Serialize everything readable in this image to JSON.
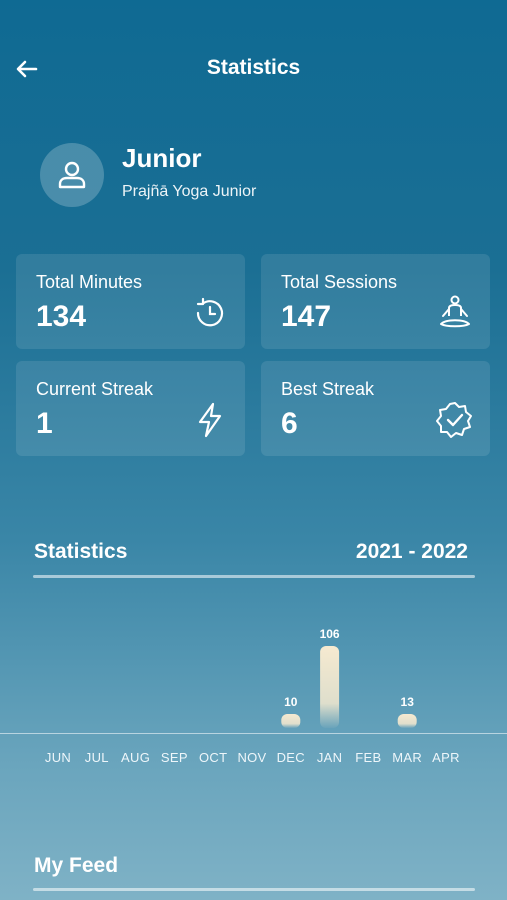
{
  "header": {
    "title": "Statistics",
    "back_icon": "arrow-left-icon"
  },
  "profile": {
    "name": "Junior",
    "subtitle": "Prajñā Yoga Junior",
    "avatar_icon": "user-icon"
  },
  "stats": [
    {
      "label": "Total Minutes",
      "value": "134",
      "icon": "timer-icon"
    },
    {
      "label": "Total Sessions",
      "value": "147",
      "icon": "meditation-icon"
    },
    {
      "label": "Current Streak",
      "value": "1",
      "icon": "lightning-icon"
    },
    {
      "label": "Best Streak",
      "value": "6",
      "icon": "badge-check-icon"
    }
  ],
  "statistics": {
    "title": "Statistics",
    "range": "2021 - 2022"
  },
  "chart_data": {
    "type": "bar",
    "categories": [
      "JUN",
      "JUL",
      "AUG",
      "SEP",
      "OCT",
      "NOV",
      "DEC",
      "JAN",
      "FEB",
      "MAR",
      "APR"
    ],
    "values": [
      0,
      0,
      0,
      0,
      0,
      0,
      10,
      106,
      0,
      13,
      0
    ],
    "title": "",
    "xlabel": "",
    "ylabel": ""
  },
  "feed": {
    "title": "My Feed"
  },
  "colors": {
    "bar": "#f6ead0",
    "background_top": "#0f6a93",
    "background_bottom": "#7fb2c6"
  }
}
